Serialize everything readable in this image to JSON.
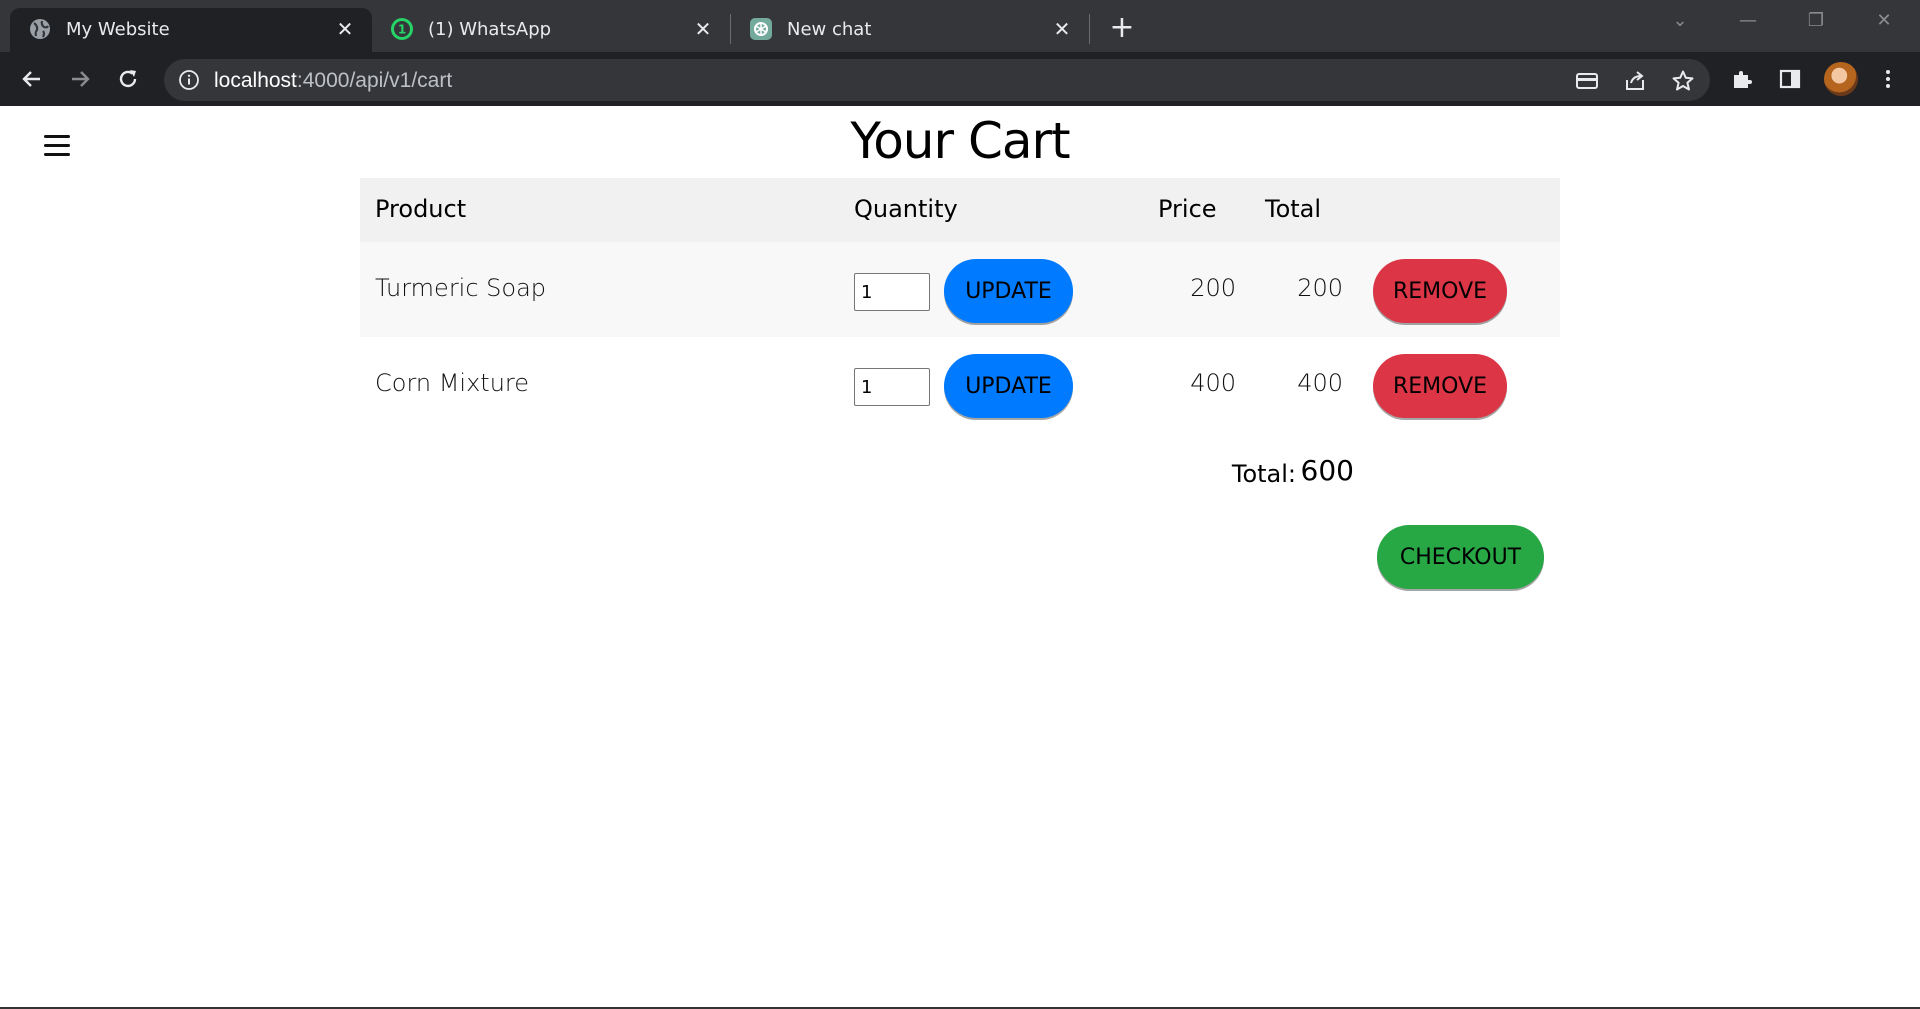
{
  "browser": {
    "tabs": [
      {
        "title": "My Website",
        "icon": "globe-icon",
        "active": true
      },
      {
        "title": "(1) WhatsApp",
        "icon": "whatsapp-icon",
        "badge": "1",
        "active": false
      },
      {
        "title": "New chat",
        "icon": "chatgpt-icon",
        "active": false
      }
    ],
    "tab_close_glyph": "✕",
    "new_tab_glyph": "+",
    "url": {
      "host": "localhost",
      "path": ":4000/api/v1/cart"
    },
    "window_controls": {
      "minimize": "—",
      "restore": "❐",
      "close": "✕",
      "tab_search": "⌄"
    },
    "colors": {
      "tabstrip": "#35363a",
      "active_tab": "#202124",
      "omnibox": "#35363a",
      "whatsapp": "#25d366"
    }
  },
  "page": {
    "title": "Your Cart",
    "table": {
      "headers": {
        "product": "Product",
        "quantity": "Quantity",
        "price": "Price",
        "total": "Total"
      },
      "rows": [
        {
          "product": "Turmeric Soap",
          "quantity": "1",
          "update_label": "UPDATE",
          "price": "200",
          "total": "200",
          "remove_label": "REMOVE"
        },
        {
          "product": "Corn Mixture",
          "quantity": "1",
          "update_label": "UPDATE",
          "price": "400",
          "total": "400",
          "remove_label": "REMOVE"
        }
      ]
    },
    "summary": {
      "label": "Total:",
      "value": "600"
    },
    "checkout_label": "CHECKOUT",
    "colors": {
      "update": "#007bff",
      "remove": "#dc3545",
      "checkout": "#28a745",
      "header_bg": "#f1f1f1",
      "row_alt_bg": "#f8f8f8"
    }
  }
}
